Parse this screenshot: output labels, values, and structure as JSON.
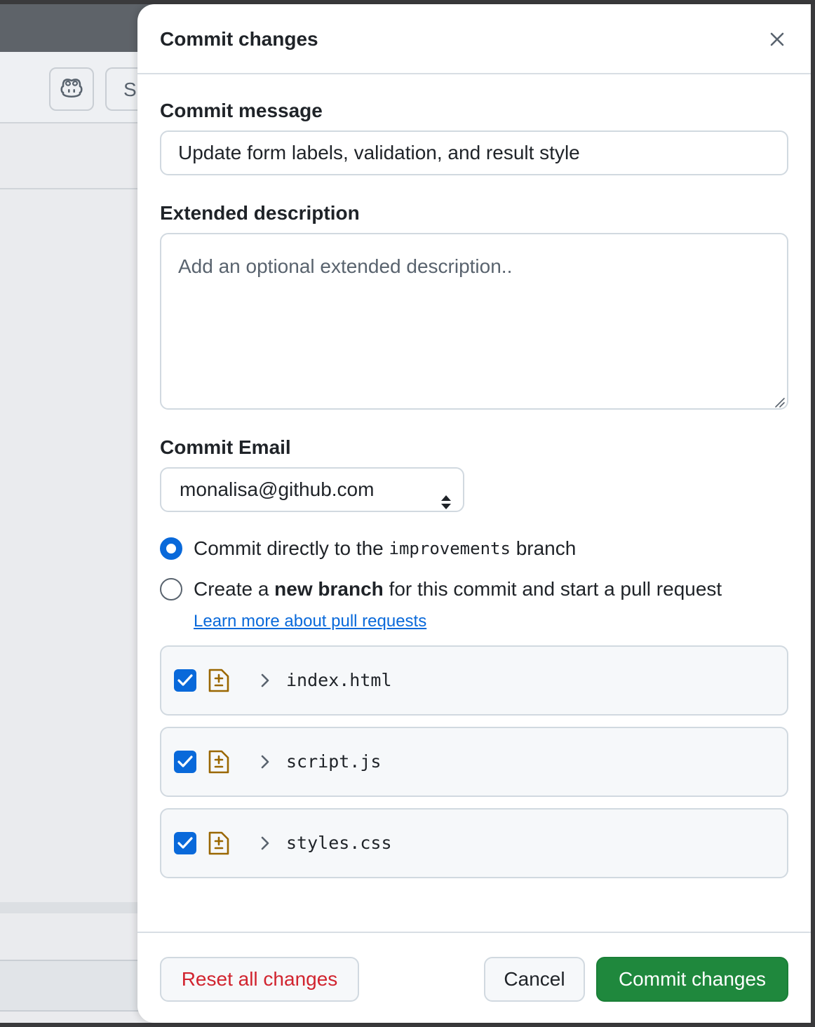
{
  "background": {
    "partial_button_label": "S"
  },
  "dialog": {
    "title": "Commit changes",
    "commit_message": {
      "label": "Commit message",
      "value": "Update form labels, validation, and result style"
    },
    "extended_description": {
      "label": "Extended description",
      "placeholder": "Add an optional extended description.."
    },
    "commit_email": {
      "label": "Commit Email",
      "selected": "monalisa@github.com"
    },
    "branch_options": {
      "direct": {
        "prefix": "Commit directly to the ",
        "branch_name": "improvements",
        "suffix": " branch",
        "checked": true
      },
      "new_branch": {
        "prefix": "Create a ",
        "bold": "new branch",
        "suffix": " for this commit and start a pull request",
        "checked": false
      },
      "learn_more_link": "Learn more about pull requests"
    },
    "files": [
      {
        "name": "index.html",
        "checked": true,
        "icon": "file-diff-icon"
      },
      {
        "name": "script.js",
        "checked": true,
        "icon": "file-diff-icon"
      },
      {
        "name": "styles.css",
        "checked": true,
        "icon": "file-diff-icon"
      }
    ],
    "footer": {
      "reset_label": "Reset all changes",
      "cancel_label": "Cancel",
      "commit_label": "Commit changes"
    }
  },
  "colors": {
    "accent_blue": "#0969da",
    "commit_green": "#1f883d",
    "danger_red": "#d1242f",
    "diff_icon_amber": "#9a6700"
  }
}
